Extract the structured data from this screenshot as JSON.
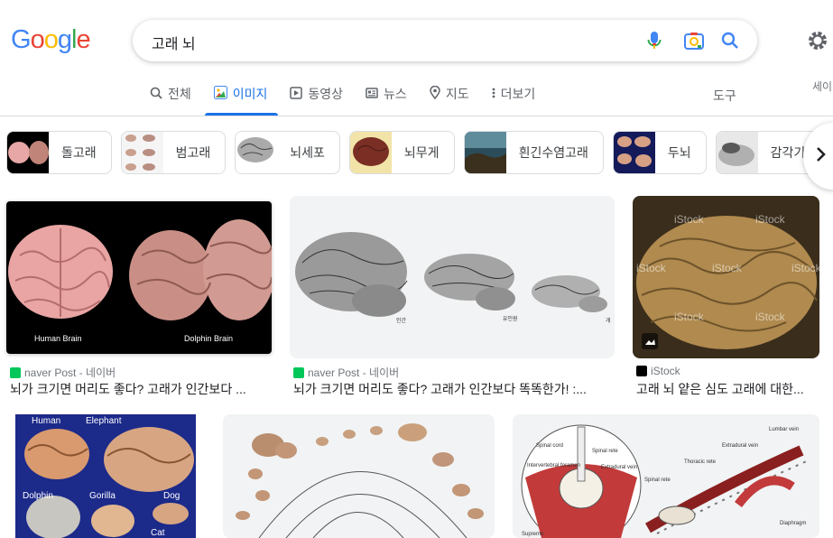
{
  "logo": {
    "letters": [
      "G",
      "o",
      "o",
      "g",
      "l",
      "e"
    ]
  },
  "search": {
    "query": "고래 뇌"
  },
  "tabs": [
    {
      "label": "전체",
      "icon": "search-icon"
    },
    {
      "label": "이미지",
      "icon": "image-icon"
    },
    {
      "label": "동영상",
      "icon": "video-icon"
    },
    {
      "label": "뉴스",
      "icon": "news-icon"
    },
    {
      "label": "지도",
      "icon": "map-pin-icon"
    },
    {
      "label": "더보기",
      "icon": "more-vert-icon"
    }
  ],
  "tools_label": "도구",
  "safesearch_label": "세이",
  "chips": [
    {
      "label": "돌고래"
    },
    {
      "label": "범고래"
    },
    {
      "label": "뇌세포"
    },
    {
      "label": "뇌무게"
    },
    {
      "label": "흰긴수염고래"
    },
    {
      "label": "두뇌"
    },
    {
      "label": "감각기"
    }
  ],
  "results": [
    {
      "source": "naver Post - 네이버",
      "title": "뇌가 크기면 머리도 좋다? 고래가 인간보다 ...",
      "labels": [
        "Human Brain",
        "Dolphin Brain"
      ]
    },
    {
      "source": "naver Post - 네이버",
      "title": "뇌가 크기면 머리도 좋다? 고래가 인간보다 똑똑한가! :...",
      "labels": [
        "인간",
        "유인원",
        "개"
      ]
    },
    {
      "source": "iStock",
      "title": "고래 뇌 얕은 심도 고래에 대한...",
      "labels": [
        "iStock"
      ]
    },
    {
      "labels": [
        "Human",
        "Elephant",
        "Dolphin",
        "Gorilla",
        "Dog",
        "Cat"
      ]
    },
    {
      "labels": []
    },
    {
      "labels": [
        "Lumbar vein",
        "Spinal cord",
        "Spinal rete",
        "Extradural vein",
        "Intervertebral foramen",
        "Extradural vein",
        "Thoracic rete",
        "Spinal rete",
        "Diaphragm",
        "Supreme"
      ]
    }
  ],
  "colors": {
    "accent": "#1a73e8",
    "text": "#202124",
    "muted": "#70757a"
  }
}
